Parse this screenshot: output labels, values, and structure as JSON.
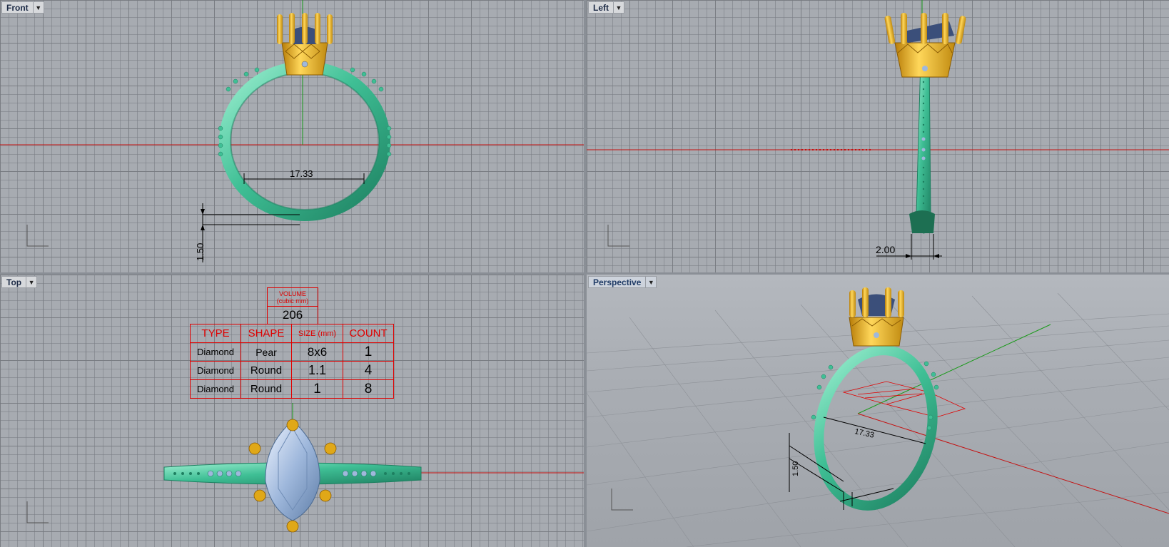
{
  "viewports": {
    "front": {
      "label": "Front"
    },
    "left": {
      "label": "Left"
    },
    "top": {
      "label": "Top"
    },
    "perspective": {
      "label": "Perspective"
    }
  },
  "dimensions": {
    "front_inner_diameter": "17.33",
    "front_band_thickness": "1.50",
    "left_band_width": "2.00",
    "persp_inner_diameter": "17.33",
    "persp_band_thickness": "1.50"
  },
  "volume": {
    "title_line1": "VOLUME",
    "title_line2": "(cubic mm)",
    "value": "206"
  },
  "stone_table": {
    "headers": [
      "TYPE",
      "SHAPE",
      "SIZE (mm)",
      "COUNT"
    ],
    "rows": [
      [
        "Diamond",
        "Pear",
        "8x6",
        "1"
      ],
      [
        "Diamond",
        "Round",
        "1.1",
        "4"
      ],
      [
        "Diamond",
        "Round",
        "1",
        "8"
      ]
    ]
  },
  "colors": {
    "band": "#3fbf95",
    "head": "#e0a818",
    "stone": "#9fb8dc",
    "axis_x": "#c41010",
    "axis_y": "#1a9a1a",
    "table_red": "#e00000"
  }
}
